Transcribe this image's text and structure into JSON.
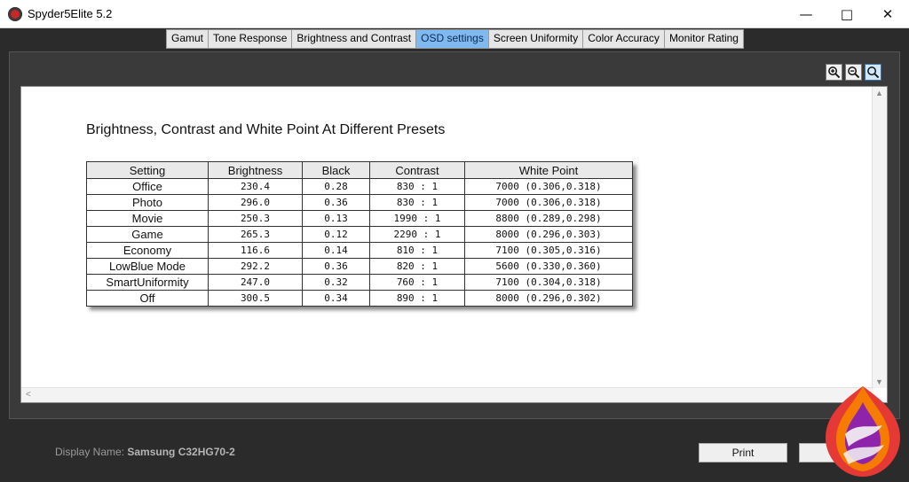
{
  "window": {
    "title": "Spyder5Elite 5.2"
  },
  "tabs": [
    {
      "label": "Gamut",
      "active": false
    },
    {
      "label": "Tone Response",
      "active": false
    },
    {
      "label": "Brightness and Contrast",
      "active": false
    },
    {
      "label": "OSD settings",
      "active": true
    },
    {
      "label": "Screen Uniformity",
      "active": false
    },
    {
      "label": "Color Accuracy",
      "active": false
    },
    {
      "label": "Monitor Rating",
      "active": false
    }
  ],
  "zoom_tools": [
    "zoom-in-icon",
    "zoom-out-icon",
    "zoom-fit-icon"
  ],
  "report": {
    "title": "Brightness, Contrast and White Point At Different Presets",
    "columns": [
      "Setting",
      "Brightness",
      "Black",
      "Contrast",
      "White Point"
    ],
    "rows": [
      [
        "Office",
        "230.4",
        "0.28",
        "830 : 1",
        "7000 (0.306,0.318)"
      ],
      [
        "Photo",
        "296.0",
        "0.36",
        "830 : 1",
        "7000 (0.306,0.318)"
      ],
      [
        "Movie",
        "250.3",
        "0.13",
        "1990 : 1",
        "8800 (0.289,0.298)"
      ],
      [
        "Game",
        "265.3",
        "0.12",
        "2290 : 1",
        "8000 (0.296,0.303)"
      ],
      [
        "Economy",
        "116.6",
        "0.14",
        "810 : 1",
        "7100 (0.305,0.316)"
      ],
      [
        "LowBlue Mode",
        "292.2",
        "0.36",
        "820 : 1",
        "5600 (0.330,0.360)"
      ],
      [
        "SmartUniformity",
        "247.0",
        "0.32",
        "760 : 1",
        "7100 (0.304,0.318)"
      ],
      [
        "Off",
        "300.5",
        "0.34",
        "890 : 1",
        "8000 (0.296,0.302)"
      ]
    ]
  },
  "footer": {
    "display_label": "Display Name:",
    "display_value": "Samsung C32HG70-2",
    "print_label": "Print"
  },
  "colors": {
    "active_tab": "#7fb9ef",
    "background": "#2b2b2b"
  }
}
